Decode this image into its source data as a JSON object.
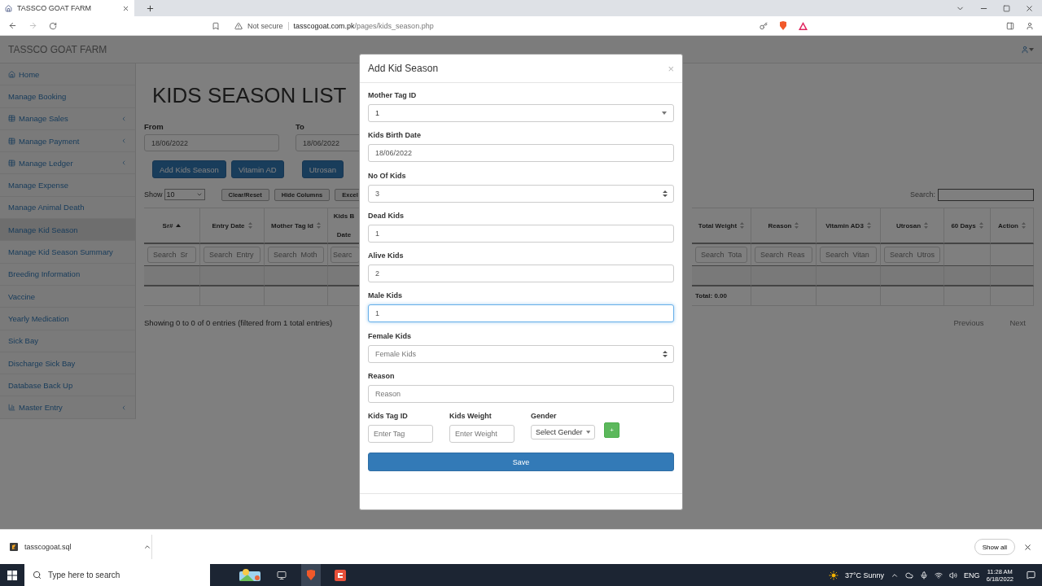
{
  "browser": {
    "tab_title": "TASSCO GOAT FARM",
    "security": "Not secure",
    "url_host": "tasscogoat.com.pk",
    "url_path": "/pages/kids_season.php"
  },
  "app": {
    "brand": "TASSCO GOAT FARM"
  },
  "sidebar": {
    "items": [
      {
        "label": "Home",
        "kind": "home",
        "submenu": false,
        "selected": false
      },
      {
        "label": "Manage Booking",
        "kind": "plain",
        "submenu": false,
        "selected": false
      },
      {
        "label": "Manage Sales",
        "kind": "table",
        "submenu": true,
        "selected": false
      },
      {
        "label": "Manage Payment",
        "kind": "table",
        "submenu": true,
        "selected": false
      },
      {
        "label": "Manage Ledger",
        "kind": "table",
        "submenu": true,
        "selected": false
      },
      {
        "label": "Manage Expense",
        "kind": "plain",
        "submenu": false,
        "selected": false
      },
      {
        "label": "Manage Animal Death",
        "kind": "plain",
        "submenu": false,
        "selected": false
      },
      {
        "label": "Manage Kid Season",
        "kind": "plain",
        "submenu": false,
        "selected": true
      },
      {
        "label": "Manage Kid Season Summary",
        "kind": "plain",
        "submenu": false,
        "selected": false
      },
      {
        "label": "Breeding Information",
        "kind": "plain",
        "submenu": false,
        "selected": false
      },
      {
        "label": "Vaccine",
        "kind": "plain",
        "submenu": false,
        "selected": false
      },
      {
        "label": "Yearly Medication",
        "kind": "plain",
        "submenu": false,
        "selected": false
      },
      {
        "label": "Sick Bay",
        "kind": "plain",
        "submenu": false,
        "selected": false
      },
      {
        "label": "Discharge Sick Bay",
        "kind": "plain",
        "submenu": false,
        "selected": false
      },
      {
        "label": "Database Back Up",
        "kind": "plain",
        "submenu": false,
        "selected": false
      },
      {
        "label": "Master Entry",
        "kind": "chart",
        "submenu": true,
        "selected": false
      }
    ]
  },
  "page": {
    "title": "KIDS SEASON LIST",
    "filters": [
      {
        "label": "From",
        "value": "18/06/2022"
      },
      {
        "label": "To",
        "value": "18/06/2022"
      }
    ],
    "action_buttons": [
      "Add Kids Season",
      "Vitamin AD",
      "Utrosan"
    ],
    "show_label": "Show",
    "page_size": "10",
    "tool_buttons": [
      "Clear/Reset",
      "Hide Columns",
      "Excel"
    ],
    "search_label": "Search:",
    "table": {
      "columns": [
        {
          "label": "Sr#",
          "kind": "sorted",
          "placeholder": "Search  Sr"
        },
        {
          "label": "Entry Date",
          "kind": "sortable",
          "placeholder": "Search  Entry"
        },
        {
          "label": "Mother Tag Id",
          "kind": "sortable",
          "placeholder": "Search  Moth"
        },
        {
          "label": "Kids B",
          "label_line_2": "Date",
          "kind": "plain",
          "placeholder": "Searc"
        },
        {
          "label": "Total Weight",
          "kind": "sortable",
          "placeholder": "Search  Tota"
        },
        {
          "label": "Reason",
          "kind": "sortable",
          "placeholder": "Search  Reas"
        },
        {
          "label": "Vitamin AD3",
          "kind": "sortable",
          "placeholder": "Search  Vitan"
        },
        {
          "label": "Utrosan",
          "kind": "sortable",
          "placeholder": "Search  Utros"
        },
        {
          "label": "60 Days",
          "kind": "sortable"
        },
        {
          "label": "Action",
          "kind": "sortable"
        }
      ],
      "total": "Total: 0.00"
    },
    "info": "Showing 0 to 0 of 0 entries (filtered from 1 total entries)",
    "pagination": [
      "Previous",
      "Next"
    ]
  },
  "modal": {
    "title": "Add Kid Season",
    "close": "×",
    "fields": [
      {
        "label": "Mother Tag ID",
        "kind": "select",
        "value": "1",
        "focused": false
      },
      {
        "label": "Kids Birth Date",
        "kind": "text",
        "value": "18/06/2022",
        "focused": false
      },
      {
        "label": "No Of Kids",
        "kind": "number",
        "value": "3",
        "focused": false
      },
      {
        "label": "Dead Kids",
        "kind": "text",
        "value": "1",
        "focused": false
      },
      {
        "label": "Alive Kids",
        "kind": "text",
        "value": "2",
        "focused": false
      },
      {
        "label": "Male Kids",
        "kind": "text",
        "value": "1",
        "focused": true
      },
      {
        "label": "Female Kids",
        "kind": "number",
        "placeholder": "Female Kids",
        "focused": false
      },
      {
        "label": "Reason",
        "kind": "text",
        "placeholder": "Reason",
        "focused": false
      }
    ],
    "inline_fields": [
      {
        "label": "Kids Tag ID",
        "kind": "text",
        "placeholder": "Enter Tag"
      },
      {
        "label": "Kids Weight",
        "kind": "text",
        "placeholder": "Enter Weight"
      },
      {
        "label": "Gender",
        "kind": "select",
        "value": "Select Gender"
      }
    ],
    "add_button": "+",
    "save_button": "Save"
  },
  "downloads": {
    "file": "tasscogoat.sql",
    "show_all": "Show all"
  },
  "taskbar": {
    "search_placeholder": "Type here to search",
    "weather": "37°C  Sunny",
    "language": "ENG",
    "time": "11:28 AM",
    "date": "6/18/2022"
  }
}
